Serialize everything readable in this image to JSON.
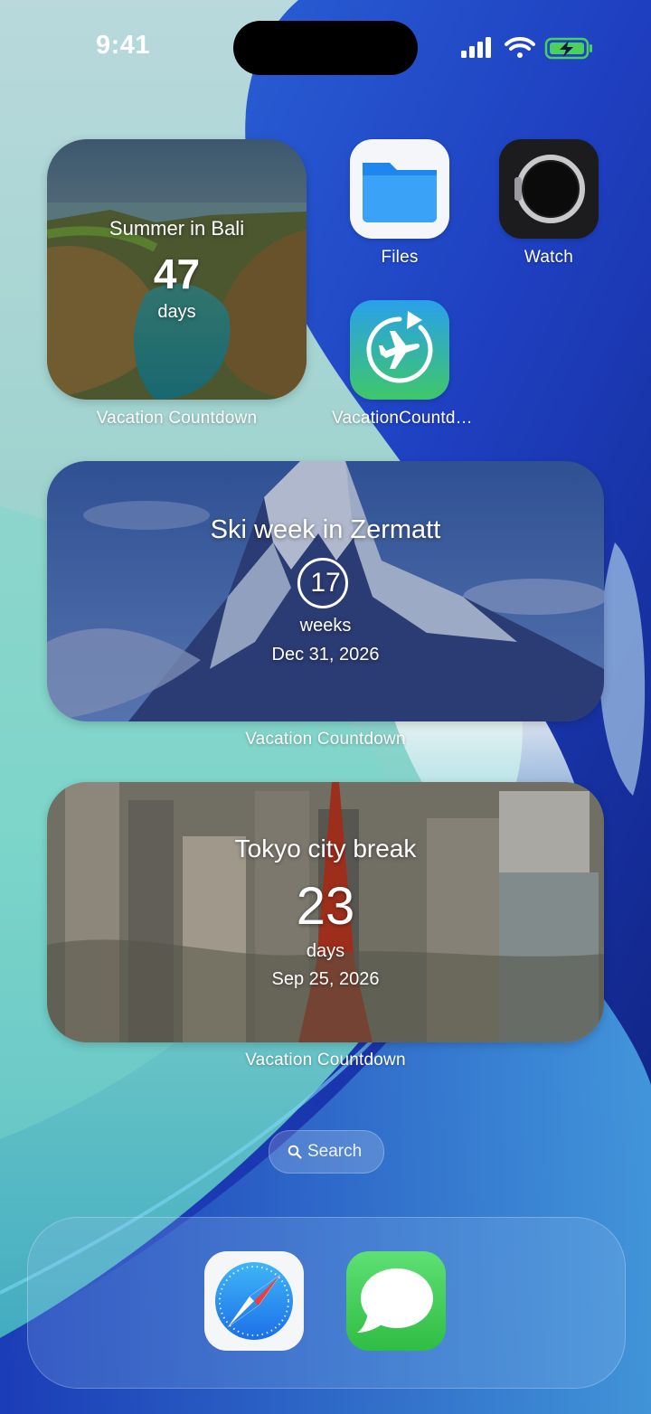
{
  "status_bar": {
    "time": "9:41"
  },
  "home_screen": {
    "widgets": [
      {
        "title": "Summer in Bali",
        "count": "47",
        "unit": "days",
        "caption": "Vacation Countdown"
      },
      {
        "title": "Ski week in Zermatt",
        "count": "17",
        "unit": "weeks",
        "date": "Dec 31, 2026",
        "caption": "Vacation Countdown"
      },
      {
        "title": "Tokyo city break",
        "count": "23",
        "unit": "days",
        "date": "Sep 25, 2026",
        "caption": "Vacation Countdown"
      }
    ],
    "apps": [
      {
        "label": "Files",
        "icon": "folder-icon"
      },
      {
        "label": "Watch",
        "icon": "watch-icon"
      },
      {
        "label": "VacationCountd…",
        "icon": "airplane-countdown-icon"
      }
    ],
    "search": {
      "label": "Search",
      "icon": "search-icon"
    }
  },
  "dock": {
    "apps": [
      {
        "name": "Safari",
        "icon": "compass-icon"
      },
      {
        "name": "Messages",
        "icon": "speech-bubble-icon"
      }
    ]
  },
  "colors": {
    "wallpaper_blue": "#2148c8",
    "wallpaper_teal": "#5cc7bf",
    "files_blue": "#2a8ff2",
    "vacation_green": "#3ec76a",
    "messages_green": "#36c74f",
    "safari_blue": "#1f8ff0"
  }
}
